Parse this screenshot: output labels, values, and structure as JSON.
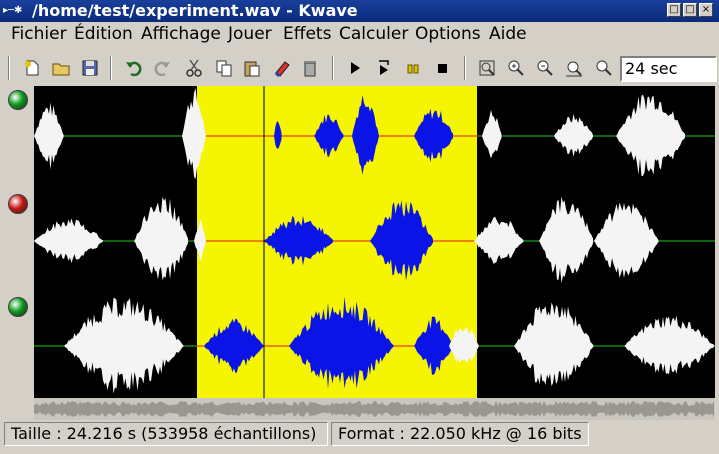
{
  "window": {
    "title": "/home/test/experiment.wav - Kwave",
    "sysmenu_glyph": "▸─✱",
    "button_glyphs": {
      "iconify": "□",
      "maximize": "□",
      "close": "×"
    }
  },
  "menubar": {
    "items": [
      "Fichier",
      "Édition",
      "Affichage",
      "Jouer",
      "Effets",
      "Calculer",
      "Options",
      "Aide"
    ]
  },
  "toolbar": {
    "icons": [
      "new-file-icon",
      "open-folder-icon",
      "save-disk-icon",
      "undo-icon",
      "redo-icon",
      "cut-scissors-icon",
      "copy-icon",
      "paste-icon",
      "erase-icon",
      "trash-icon",
      "play-icon",
      "loop-play-icon",
      "pause-icon",
      "stop-icon",
      "zoom-all-icon",
      "zoom-in-icon",
      "zoom-out-icon",
      "zoom-selection-icon",
      "zoom-normal-icon"
    ],
    "zoom_value": "24 sec"
  },
  "tracks": [
    {
      "led": "enabled",
      "color": "#0a9a1a"
    },
    {
      "led": "disabled",
      "color": "#c81414"
    },
    {
      "led": "enabled",
      "color": "#0a9a1a"
    }
  ],
  "colors": {
    "waveform": "#f4f4f4",
    "waveform_selected": "#0a14e6",
    "selection": "#f5f500",
    "zero_line": "#1ec81e",
    "zero_line_selected": "#e61414",
    "background": "#000000"
  },
  "statusbar": {
    "size": "Taille : 24.216 s (533958 échantillons)",
    "format": "Format : 22.050 kHz @ 16 bits"
  }
}
